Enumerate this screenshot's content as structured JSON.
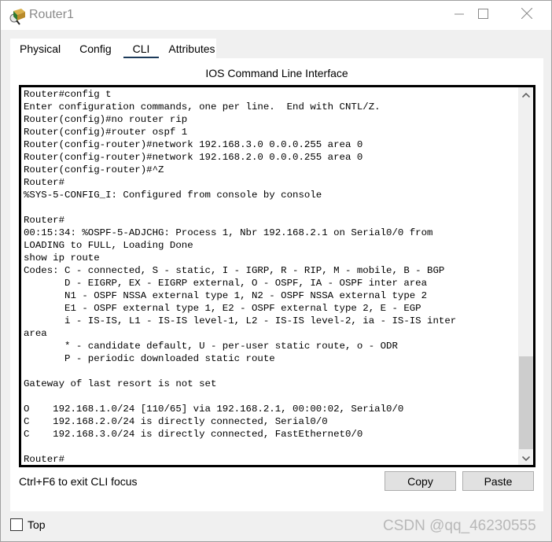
{
  "window": {
    "title": "Router1",
    "icon": "router-device-icon",
    "controls": {
      "minimize": "minimize-icon",
      "maximize": "maximize-icon",
      "close": "close-icon"
    }
  },
  "tabs": [
    {
      "label": "Physical",
      "active": false
    },
    {
      "label": "Config",
      "active": false
    },
    {
      "label": "CLI",
      "active": true
    },
    {
      "label": "Attributes",
      "active": false
    }
  ],
  "panel": {
    "title": "IOS Command Line Interface"
  },
  "terminal": {
    "lines": [
      "Router#config t",
      "Enter configuration commands, one per line.  End with CNTL/Z.",
      "Router(config)#no router rip",
      "Router(config)#router ospf 1",
      "Router(config-router)#network 192.168.3.0 0.0.0.255 area 0",
      "Router(config-router)#network 192.168.2.0 0.0.0.255 area 0",
      "Router(config-router)#^Z",
      "Router#",
      "%SYS-5-CONFIG_I: Configured from console by console",
      "",
      "Router#",
      "00:15:34: %OSPF-5-ADJCHG: Process 1, Nbr 192.168.2.1 on Serial0/0 from",
      "LOADING to FULL, Loading Done",
      "show ip route",
      "Codes: C - connected, S - static, I - IGRP, R - RIP, M - mobile, B - BGP",
      "       D - EIGRP, EX - EIGRP external, O - OSPF, IA - OSPF inter area",
      "       N1 - OSPF NSSA external type 1, N2 - OSPF NSSA external type 2",
      "       E1 - OSPF external type 1, E2 - OSPF external type 2, E - EGP",
      "       i - IS-IS, L1 - IS-IS level-1, L2 - IS-IS level-2, ia - IS-IS inter",
      "area",
      "       * - candidate default, U - per-user static route, o - ODR",
      "       P - periodic downloaded static route",
      "",
      "Gateway of last resort is not set",
      "",
      "O    192.168.1.0/24 [110/65] via 192.168.2.1, 00:00:02, Serial0/0",
      "C    192.168.2.0/24 is directly connected, Serial0/0",
      "C    192.168.3.0/24 is directly connected, FastEthernet0/0",
      "",
      "Router#"
    ],
    "scroll_position": "bottom"
  },
  "footer": {
    "hint": "Ctrl+F6 to exit CLI focus",
    "copy_label": "Copy",
    "paste_label": "Paste"
  },
  "bottom": {
    "top_checkbox_label": "Top",
    "top_checked": false,
    "watermark": "CSDN @qq_46230555"
  }
}
